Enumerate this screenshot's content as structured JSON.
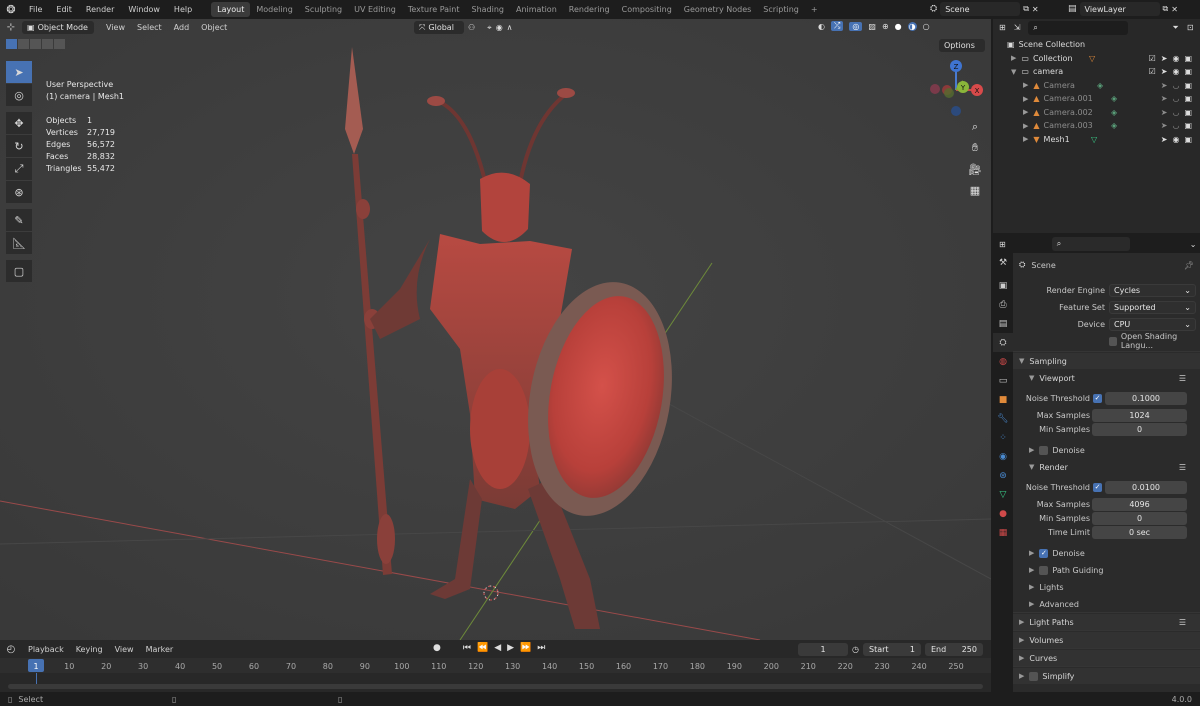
{
  "menubar": {
    "items": [
      "File",
      "Edit",
      "Render",
      "Window",
      "Help"
    ],
    "workspaces": [
      "Layout",
      "Modeling",
      "Sculpting",
      "UV Editing",
      "Texture Paint",
      "Shading",
      "Animation",
      "Rendering",
      "Compositing",
      "Geometry Nodes",
      "Scripting"
    ],
    "active_workspace": "Layout",
    "add_tab": "+",
    "scene_name": "Scene",
    "view_layer": "ViewLayer"
  },
  "viewport": {
    "mode": "Object Mode",
    "menus": [
      "View",
      "Select",
      "Add",
      "Object"
    ],
    "transform_orientation": "Global",
    "options_label": "Options",
    "overlay_title": "User Perspective",
    "overlay_subtitle": "(1) camera | Mesh1",
    "stats": [
      {
        "label": "Objects",
        "value": "1"
      },
      {
        "label": "Vertices",
        "value": "27,719"
      },
      {
        "label": "Edges",
        "value": "56,572"
      },
      {
        "label": "Faces",
        "value": "28,832"
      },
      {
        "label": "Triangles",
        "value": "55,472"
      }
    ],
    "gizmo": {
      "z": "Z",
      "y": "Y",
      "x": "X"
    }
  },
  "timeline": {
    "menus": [
      "Playback",
      "Keying",
      "View",
      "Marker"
    ],
    "current_frame": "1",
    "start_label": "Start",
    "start": "1",
    "end_label": "End",
    "end": "250",
    "frame_numbers": [
      "1",
      "10",
      "20",
      "30",
      "40",
      "50",
      "60",
      "70",
      "80",
      "90",
      "100",
      "110",
      "120",
      "130",
      "140",
      "150",
      "160",
      "170",
      "180",
      "190",
      "200",
      "210",
      "220",
      "230",
      "240",
      "250"
    ]
  },
  "statusbar": {
    "left": "Select",
    "version": "4.0.0"
  },
  "outliner": {
    "root": "Scene Collection",
    "rows": [
      {
        "label": "Collection",
        "indent": 1,
        "dim": false
      },
      {
        "label": "camera",
        "indent": 1,
        "dim": false
      },
      {
        "label": "Camera",
        "indent": 2,
        "dim": true
      },
      {
        "label": "Camera.001",
        "indent": 2,
        "dim": true
      },
      {
        "label": "Camera.002",
        "indent": 2,
        "dim": true
      },
      {
        "label": "Camera.003",
        "indent": 2,
        "dim": true
      },
      {
        "label": "Mesh1",
        "indent": 2,
        "dim": false
      }
    ]
  },
  "properties": {
    "context": "Scene",
    "render_engine_label": "Render Engine",
    "render_engine": "Cycles",
    "feature_set_label": "Feature Set",
    "feature_set": "Supported",
    "device_label": "Device",
    "device": "CPU",
    "osl_label": "Open Shading Langu...",
    "sampling": "Sampling",
    "viewport_label": "Viewport",
    "noise_threshold_label": "Noise Threshold",
    "viewport_noise": "0.1000",
    "max_samples_label": "Max Samples",
    "viewport_max": "1024",
    "min_samples_label": "Min Samples",
    "viewport_min": "0",
    "denoise_label": "Denoise",
    "render_label": "Render",
    "render_noise": "0.0100",
    "render_max": "4096",
    "render_min": "0",
    "time_limit_label": "Time Limit",
    "time_limit": "0 sec",
    "path_guiding": "Path Guiding",
    "lights": "Lights",
    "advanced": "Advanced",
    "light_paths": "Light Paths",
    "volumes": "Volumes",
    "curves": "Curves",
    "simplify": "Simplify"
  }
}
